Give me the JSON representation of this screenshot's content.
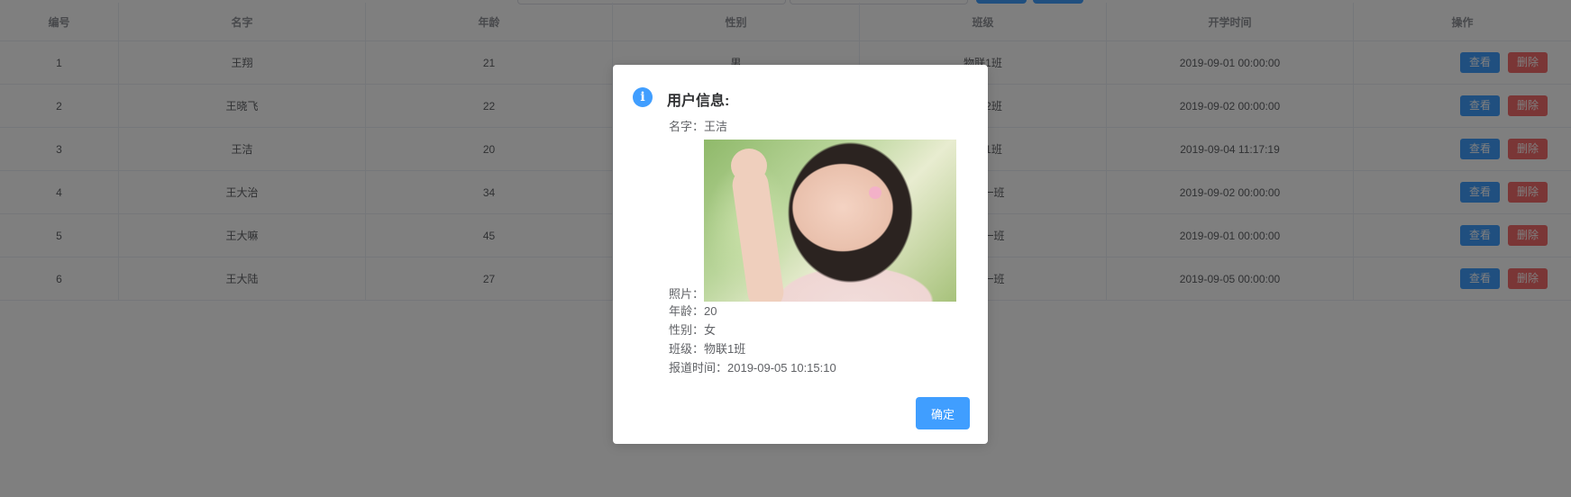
{
  "table": {
    "headers": [
      "编号",
      "名字",
      "年龄",
      "性别",
      "班级",
      "开学时间",
      "操作"
    ],
    "rows": [
      {
        "id": "1",
        "name": "王翔",
        "age": "21",
        "gender": "男",
        "cls": "物联1班",
        "date": "2019-09-01 00:00:00"
      },
      {
        "id": "2",
        "name": "王晓飞",
        "age": "22",
        "gender": "",
        "cls": "物联2班",
        "date": "2019-09-02 00:00:00"
      },
      {
        "id": "3",
        "name": "王洁",
        "age": "20",
        "gender": "",
        "cls": "物联1班",
        "date": "2019-09-04 11:17:19"
      },
      {
        "id": "4",
        "name": "王大治",
        "age": "34",
        "gender": "",
        "cls": "篮球一班",
        "date": "2019-09-02 00:00:00"
      },
      {
        "id": "5",
        "name": "王大嘛",
        "age": "45",
        "gender": "",
        "cls": "厨师一班",
        "date": "2019-09-01 00:00:00"
      },
      {
        "id": "6",
        "name": "王大陆",
        "age": "27",
        "gender": "",
        "cls": "陆军一班",
        "date": "2019-09-05 00:00:00"
      }
    ],
    "view_label": "查看",
    "delete_label": "删除"
  },
  "dialog": {
    "title": "用户信息:",
    "icon": "info-icon",
    "name_line": "名字：王洁",
    "photo_label": "照片：",
    "age_line": "年龄：20",
    "gender_line": "性别：女",
    "class_line": "班级：物联1班",
    "report_line": "报道时间：2019-09-05 10:15:10",
    "confirm_label": "确定"
  },
  "colors": {
    "primary": "#409eff",
    "danger": "#f56c6c",
    "overlay": "rgba(0,0,0,0.5)"
  }
}
